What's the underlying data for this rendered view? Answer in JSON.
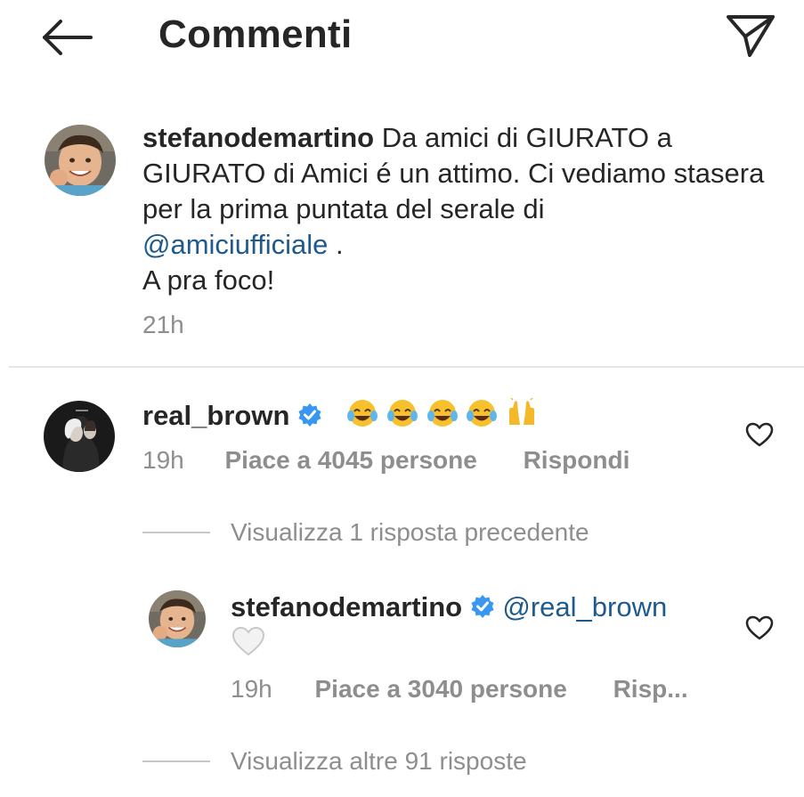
{
  "header": {
    "title": "Commenti",
    "back_icon": "arrow-left-icon",
    "send_icon": "paper-plane-icon"
  },
  "post": {
    "username": "stefanodemartino",
    "text_1": "Da amici di GIURATO a GIURATO di Amici é un attimo. Ci vediamo stasera per la prima puntata del serale di",
    "mention": "@amiciufficiale",
    "text_2": " .",
    "text_3": "A pra foco!",
    "time": "21h"
  },
  "comment": {
    "username": "real_brown",
    "time": "19h",
    "likes": "Piace a 4045 persone",
    "reply_label": "Rispondi",
    "emojis": [
      "face-with-tears-of-joy",
      "face-with-tears-of-joy",
      "face-with-tears-of-joy",
      "face-with-tears-of-joy",
      "raising-hands"
    ]
  },
  "view_previous": "Visualizza 1 risposta precedente",
  "reply": {
    "username": "stefanodemartino",
    "mention": "@real_brown",
    "emoji": "white-heart",
    "time": "19h",
    "likes": "Piace a 3040 persone",
    "reply_label": "Risp..."
  },
  "view_more": "Visualizza altre 91 risposte",
  "colors": {
    "text": "#262626",
    "secondary": "#8e8e8e",
    "mention": "#1f5a8f",
    "verified": "#3897f0"
  }
}
